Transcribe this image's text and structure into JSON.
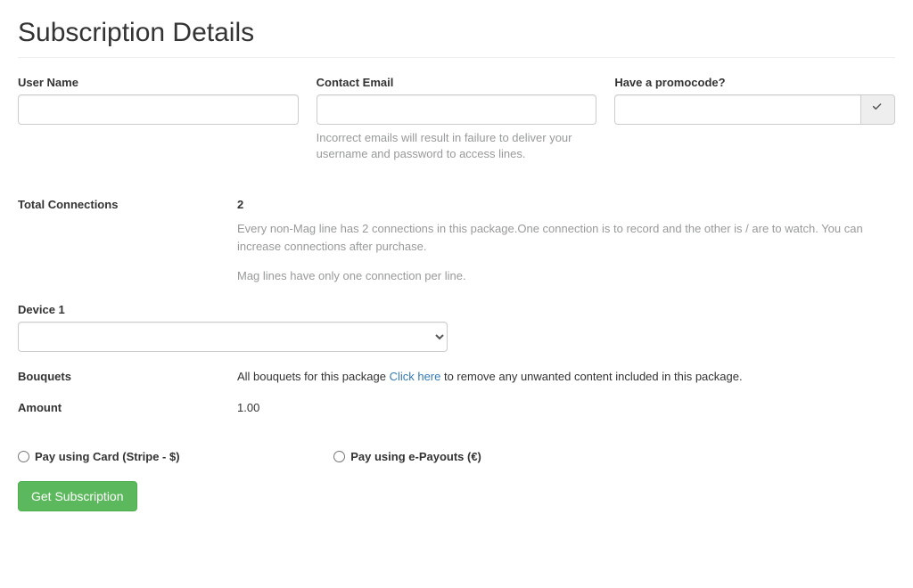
{
  "title": "Subscription Details",
  "fields": {
    "username": {
      "label": "User Name",
      "value": ""
    },
    "email": {
      "label": "Contact Email",
      "value": "",
      "help": "Incorrect emails will result in failure to deliver your username and password to access lines."
    },
    "promo": {
      "label": "Have a promocode?",
      "value": ""
    }
  },
  "connections": {
    "label": "Total Connections",
    "value": "2",
    "desc1": "Every non-Mag line has 2 connections in this package.One connection is to record and the other is / are to watch. You can increase connections after purchase.",
    "desc2": "Mag lines have only one connection per line."
  },
  "device1": {
    "label": "Device 1"
  },
  "bouquets": {
    "label": "Bouquets",
    "prefix": "All bouquets for this package ",
    "link": "Click here",
    "suffix": " to remove any unwanted content included in this package."
  },
  "amount": {
    "label": "Amount",
    "value": "1.00"
  },
  "pay": {
    "stripe": "Pay using Card (Stripe - $)",
    "epayouts": "Pay using e-Payouts (€)"
  },
  "submit": "Get Subscription"
}
